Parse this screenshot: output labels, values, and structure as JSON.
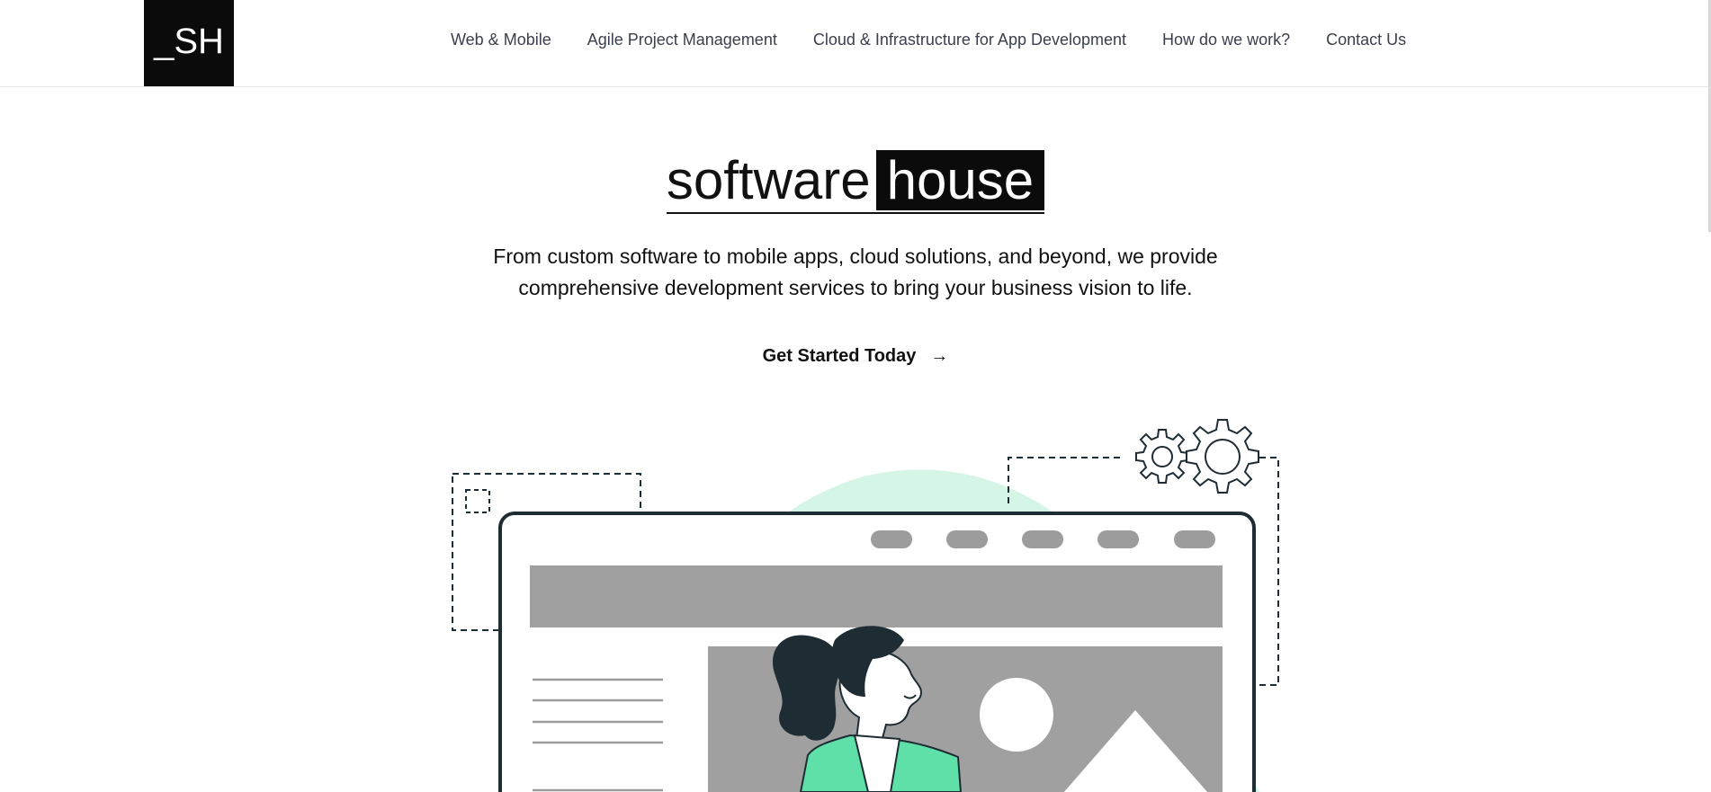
{
  "header": {
    "logo_text": "_SH",
    "nav": [
      {
        "label": "Web & Mobile"
      },
      {
        "label": "Agile Project Management"
      },
      {
        "label": "Cloud & Infrastructure for App Development"
      },
      {
        "label": "How do we work?"
      },
      {
        "label": "Contact Us"
      }
    ]
  },
  "hero": {
    "title_plain": "software",
    "title_highlight": "house",
    "subtitle_line1": "From custom software to mobile apps, cloud solutions, and beyond, we provide",
    "subtitle_line2": "comprehensive development services to bring your business vision to life.",
    "cta_label": "Get Started Today",
    "cta_arrow": "→"
  },
  "illustration": {
    "colors": {
      "blob": "#d5f5e6",
      "dark": "#1e2d33",
      "gray": "#a0a0a0",
      "pill": "#9c9c9c",
      "accent_green": "#5fe0a8",
      "white": "#ffffff"
    },
    "icons": [
      "gear-icon",
      "image-placeholder-icon"
    ]
  }
}
